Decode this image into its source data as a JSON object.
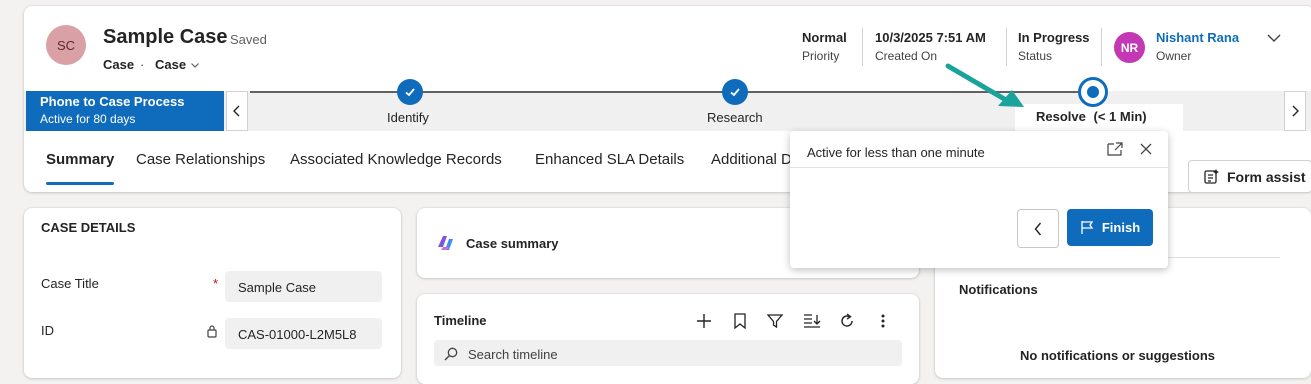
{
  "record": {
    "avatar": "SC",
    "title": "Sample Case",
    "saved": "- Saved",
    "entity": "Case",
    "dot": "·",
    "form": "Case",
    "form_icon": "chevron-down-icon"
  },
  "header_fields": [
    {
      "value": "Normal",
      "label": "Priority"
    },
    {
      "value": "10/3/2025 7:51 AM",
      "label": "Created On"
    },
    {
      "value": "In Progress",
      "label": "Status"
    }
  ],
  "owner": {
    "avatar": "NR",
    "name": "Nishant Rana",
    "label": "Owner"
  },
  "process": {
    "name": "Phone to Case Process",
    "active": "Active for 80 days",
    "stages": [
      "Identify",
      "Research",
      "Resolve"
    ],
    "active_stage_time": "(< 1 Min)"
  },
  "tabs": [
    "Summary",
    "Case Relationships",
    "Associated Knowledge Records",
    "Enhanced SLA Details",
    "Additional D"
  ],
  "form_assist": "Form assist",
  "popup": {
    "title": "Active for less than one minute",
    "finish": "Finish"
  },
  "case_details": {
    "heading": "CASE DETAILS",
    "title_label": "Case Title",
    "required": "*",
    "title_value": "Sample Case",
    "id_label": "ID",
    "id_value": "CAS-01000-L2M5L8"
  },
  "case_summary": {
    "label": "Case summary"
  },
  "timeline": {
    "title": "Timeline",
    "search_placeholder": "Search timeline"
  },
  "notifications": {
    "title": "Notifications",
    "empty": "No notifications or suggestions"
  },
  "colors": {
    "accent": "#0f6cbd",
    "arrow": "#1aa39a"
  }
}
